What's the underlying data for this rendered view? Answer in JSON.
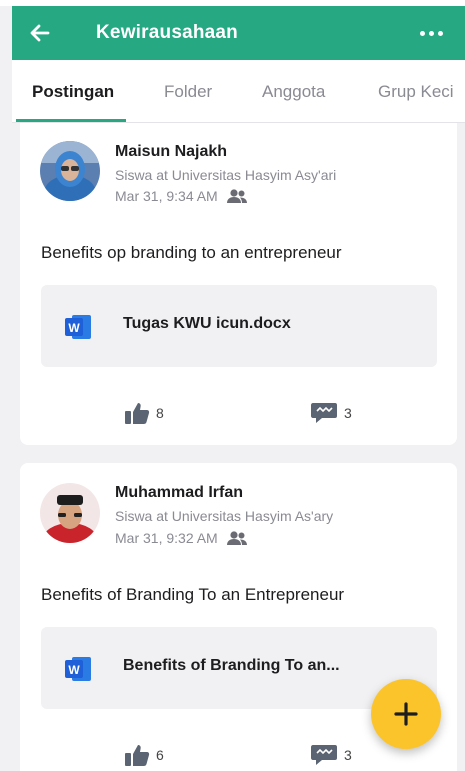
{
  "header": {
    "title": "Kewirausahaan",
    "back_icon": "arrow-left-icon",
    "more_icon": "more-horizontal-icon"
  },
  "tabs": [
    {
      "label": "Postingan",
      "active": true
    },
    {
      "label": "Folder",
      "active": false
    },
    {
      "label": "Anggota",
      "active": false
    },
    {
      "label": "Grup Keci",
      "active": false
    }
  ],
  "posts": [
    {
      "author": "Maisun Najakh",
      "subtitle": "Siswa at Universitas Hasyim Asy'ari",
      "timestamp": "Mar 31, 9:34 AM",
      "body": "Benefits op branding to an entrepreneur",
      "attachment": {
        "name": "Tugas KWU icun.docx",
        "icon": "word-doc-icon"
      },
      "likes": "8",
      "comments": "3"
    },
    {
      "author": "Muhammad Irfan",
      "subtitle": "Siswa at Universitas Hasyim As'ary",
      "timestamp": "Mar 31, 9:32 AM",
      "body": "Benefits of Branding To an Entrepreneur",
      "attachment": {
        "name": "Benefits of Branding To an...",
        "icon": "word-doc-icon"
      },
      "likes": "6",
      "comments": "3"
    }
  ],
  "fab": {
    "icon": "plus-icon"
  },
  "colors": {
    "primary": "#26a882",
    "fab": "#fcc42b",
    "word": "#1f5fd8"
  }
}
